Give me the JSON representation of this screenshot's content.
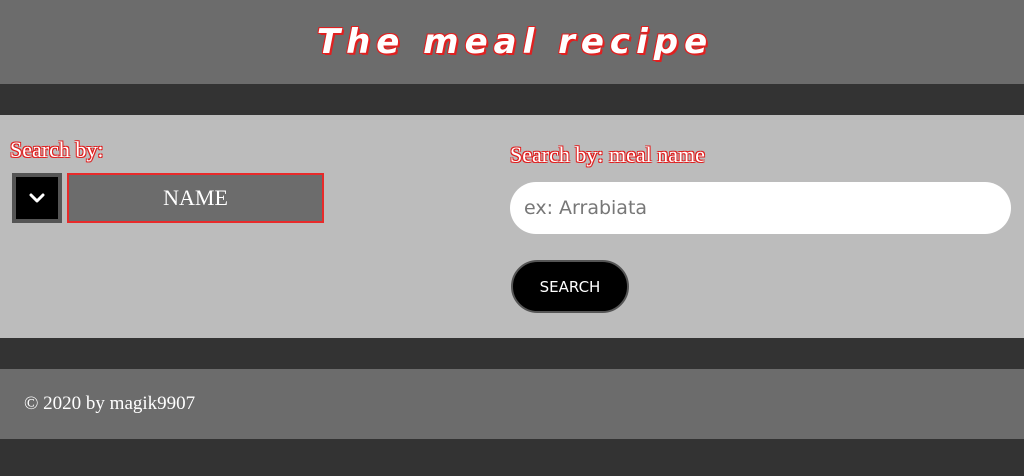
{
  "header": {
    "title": "The meal recipe"
  },
  "search": {
    "left_label": "Search by:",
    "selected_option": "NAME",
    "right_label": "Search by: meal name",
    "placeholder": "ex: Arrabiata",
    "value": "",
    "button_label": "SEARCH",
    "toggle_icon": "chevron-down-icon"
  },
  "footer": {
    "copyright": "© 2020 by magik9907"
  },
  "colors": {
    "header_bg": "#6c6c6c",
    "page_bg": "#333333",
    "panel_bg": "#bcbcbc",
    "accent_red": "#e82a2a",
    "button_bg": "#000000"
  }
}
